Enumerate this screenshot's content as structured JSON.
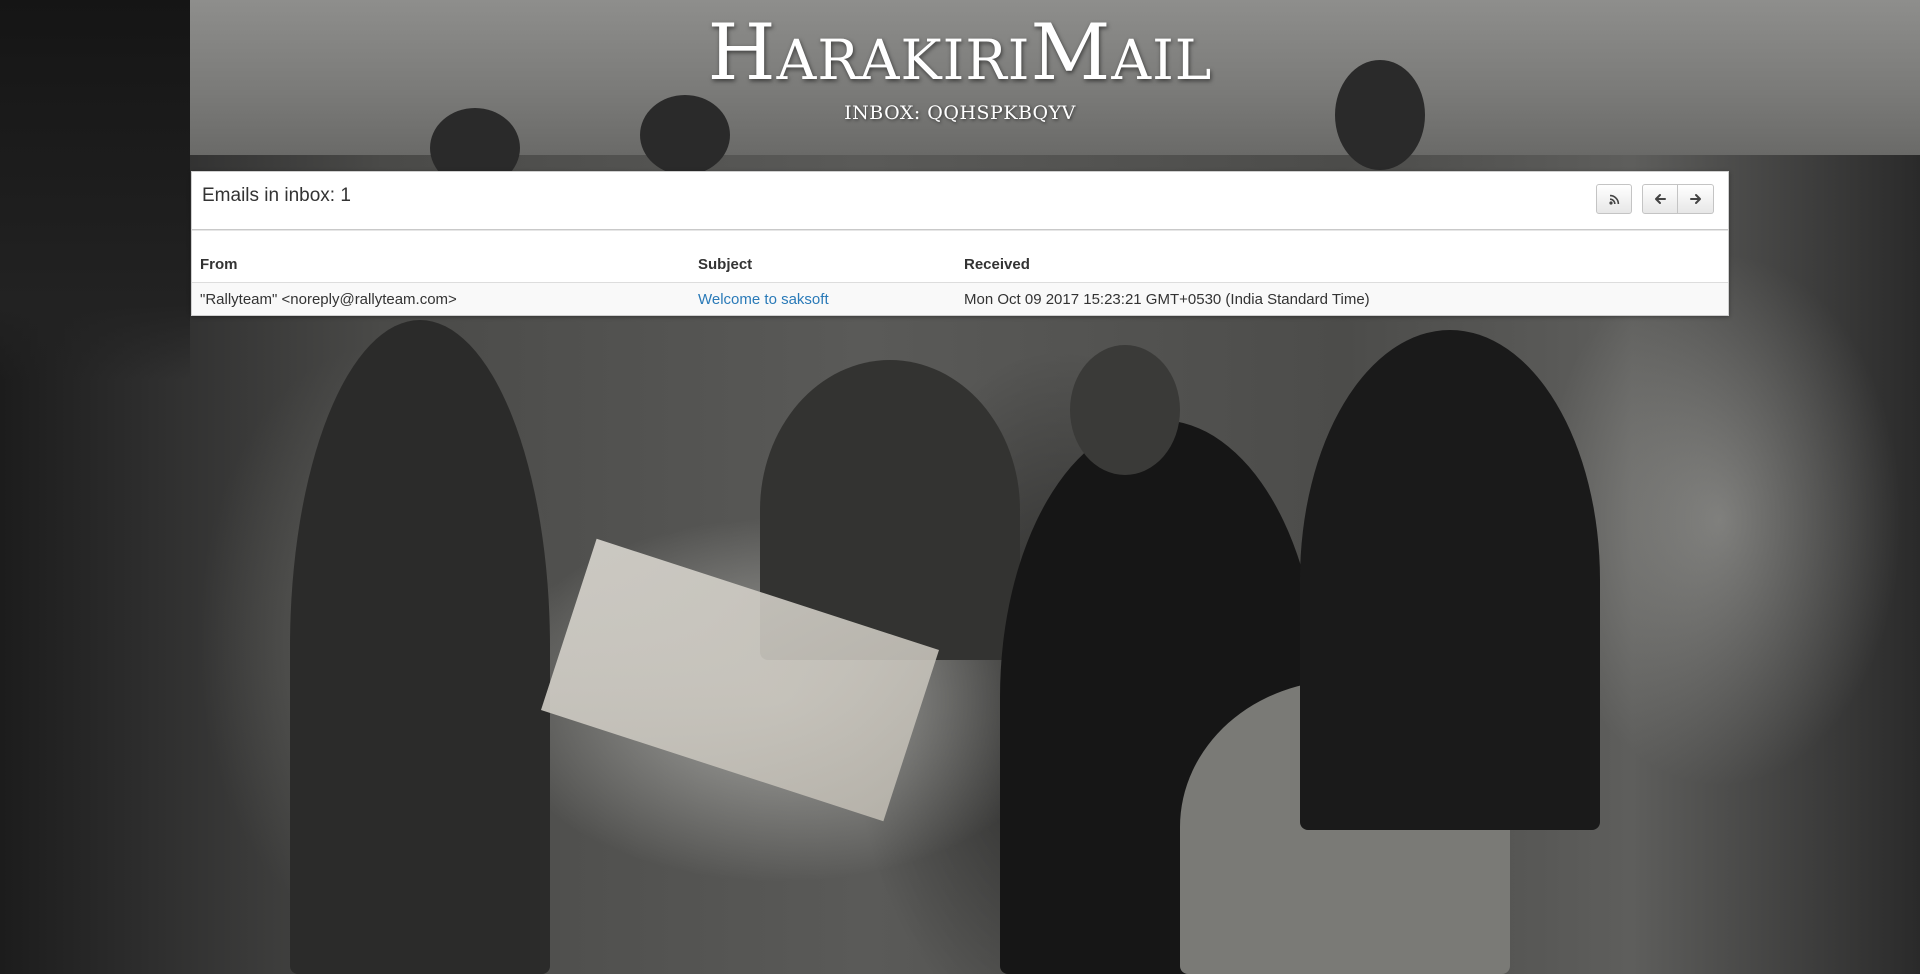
{
  "header": {
    "logo": "HarakiriMail",
    "inbox_label": "INBOX: QQHSPKBQYV"
  },
  "panel": {
    "title": "Emails in inbox: 1",
    "buttons": {
      "rss_icon": "rss-icon",
      "prev_icon": "arrow-left-icon",
      "next_icon": "arrow-right-icon"
    }
  },
  "table": {
    "headers": {
      "from": "From",
      "subject": "Subject",
      "received": "Received"
    },
    "rows": [
      {
        "from": "\"Rallyteam\" <noreply@rallyteam.com>",
        "subject": "Welcome to saksoft",
        "received": "Mon Oct 09 2017 15:23:21 GMT+0530 (India Standard Time)"
      }
    ]
  },
  "colors": {
    "link": "#2a7ab8",
    "text": "#333333",
    "panel_bg": "#ffffff"
  }
}
